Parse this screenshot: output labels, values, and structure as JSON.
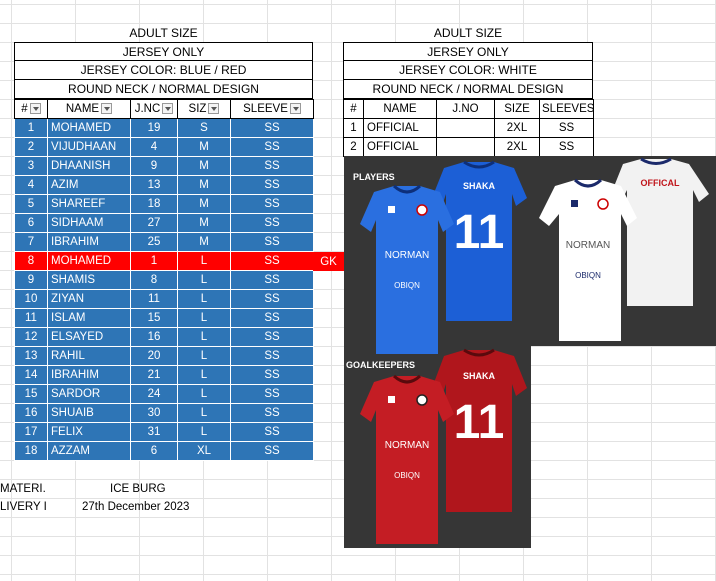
{
  "left": {
    "header_lines": [
      "ADULT SIZE",
      "JERSEY ONLY",
      "JERSEY COLOR: BLUE / RED",
      "ROUND NECK / NORMAL DESIGN"
    ],
    "columns": [
      "#",
      "NAME",
      "J.NO",
      "SIZE",
      "SLEEVES"
    ],
    "columns_visible": [
      "#",
      "NAME",
      "J.NC",
      "SIZ",
      "SLEEVE"
    ],
    "rows": [
      {
        "num": "1",
        "name": "MOHAMED",
        "jno": "19",
        "size": "S",
        "sleeves": "SS"
      },
      {
        "num": "2",
        "name": "VIJUDHAAN",
        "jno": "4",
        "size": "M",
        "sleeves": "SS"
      },
      {
        "num": "3",
        "name": "DHAANISH",
        "jno": "9",
        "size": "M",
        "sleeves": "SS"
      },
      {
        "num": "4",
        "name": "AZIM",
        "jno": "13",
        "size": "M",
        "sleeves": "SS"
      },
      {
        "num": "5",
        "name": "SHAREEF",
        "jno": "18",
        "size": "M",
        "sleeves": "SS"
      },
      {
        "num": "6",
        "name": "SIDHAAM",
        "jno": "27",
        "size": "M",
        "sleeves": "SS"
      },
      {
        "num": "7",
        "name": "IBRAHIM",
        "jno": "25",
        "size": "M",
        "sleeves": "SS"
      },
      {
        "num": "8",
        "name": "MOHAMED",
        "jno": "1",
        "size": "L",
        "sleeves": "SS"
      },
      {
        "num": "9",
        "name": "SHAMIS",
        "jno": "8",
        "size": "L",
        "sleeves": "SS"
      },
      {
        "num": "10",
        "name": "ZIYAN",
        "jno": "11",
        "size": "L",
        "sleeves": "SS"
      },
      {
        "num": "11",
        "name": "ISLAM",
        "jno": "15",
        "size": "L",
        "sleeves": "SS"
      },
      {
        "num": "12",
        "name": "ELSAYED",
        "jno": "16",
        "size": "L",
        "sleeves": "SS"
      },
      {
        "num": "13",
        "name": "RAHIL",
        "jno": "20",
        "size": "L",
        "sleeves": "SS"
      },
      {
        "num": "14",
        "name": "IBRAHIM",
        "jno": "21",
        "size": "L",
        "sleeves": "SS"
      },
      {
        "num": "15",
        "name": "SARDOR",
        "jno": "24",
        "size": "L",
        "sleeves": "SS"
      },
      {
        "num": "16",
        "name": "SHUAIB",
        "jno": "30",
        "size": "L",
        "sleeves": "SS"
      },
      {
        "num": "17",
        "name": "FELIX",
        "jno": "31",
        "size": "L",
        "sleeves": "SS"
      },
      {
        "num": "18",
        "name": "AZZAM",
        "jno": "6",
        "size": "XL",
        "sleeves": "SS"
      }
    ],
    "gk_label": "GK"
  },
  "right": {
    "header_lines": [
      "ADULT SIZE",
      "JERSEY ONLY",
      "JERSEY COLOR: WHITE",
      "ROUND NECK / NORMAL DESIGN"
    ],
    "columns": [
      "#",
      "NAME",
      "J.NO",
      "SIZE",
      "SLEEVES"
    ],
    "rows": [
      {
        "num": "1",
        "name": "OFFICIAL",
        "jno": "",
        "size": "2XL",
        "sleeves": "SS"
      },
      {
        "num": "2",
        "name": "OFFICIAL",
        "jno": "",
        "size": "2XL",
        "sleeves": "SS"
      }
    ]
  },
  "footer": {
    "material_label": "MATERI.",
    "material_value": "ICE BURG",
    "delivery_label": "LIVERY I",
    "delivery_value": "27th December 2023"
  },
  "images": {
    "players_label": "PLAYERS",
    "goalkeepers_label": "GOALKEEPERS",
    "back_name": "SHAKA",
    "back_number": "11",
    "front_brand": "NORMAN",
    "sponsor": "OBIQN",
    "official_back": "OFFICAL"
  },
  "colors": {
    "row_blue": "#2e75b6",
    "row_red": "#ff0000",
    "jersey_blue": "#1c5fd6",
    "jersey_red": "#b0161c",
    "jersey_white": "#f4f4f4"
  }
}
